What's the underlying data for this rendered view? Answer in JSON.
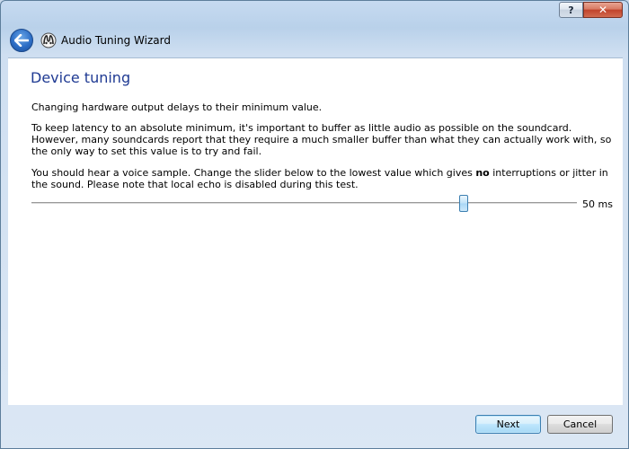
{
  "window": {
    "help_glyph": "?",
    "close_glyph": "✕"
  },
  "header": {
    "title": "Audio Tuning Wizard"
  },
  "page": {
    "title": "Device tuning",
    "intro": "Changing hardware output delays to their minimum value.",
    "explanation": "To keep latency to an absolute minimum, it's important to buffer as little audio as possible on the soundcard. However, many soundcards report that they require a much smaller buffer than what they can actually work with, so the only way to set this value is to try and fail.",
    "instruction_before": "You should hear a voice sample. Change the slider below to the lowest value which gives ",
    "instruction_bold": "no",
    "instruction_after": " interruptions or jitter in the sound. Please note that local echo is disabled during this test."
  },
  "slider": {
    "value_label": "50 ms",
    "fraction": 0.793
  },
  "footer": {
    "next_label": "Next",
    "cancel_label": "Cancel"
  },
  "icons": {
    "back": "back-arrow-icon",
    "app": "mumble-icon"
  },
  "colors": {
    "title_blue": "#1f3a93",
    "back_button": "#2d6ec6",
    "close_button": "#c0432b"
  }
}
